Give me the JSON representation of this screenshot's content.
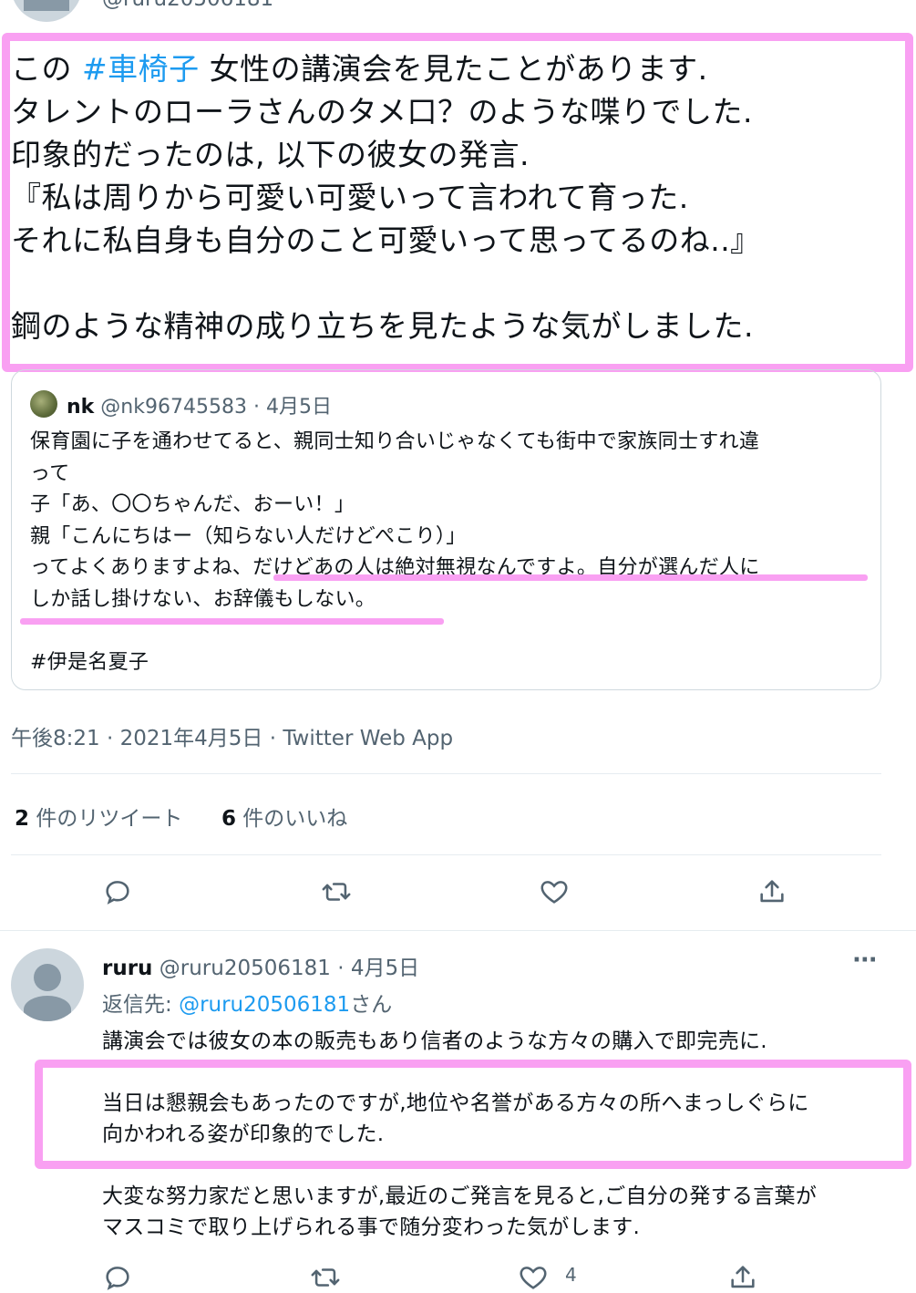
{
  "top_tweet": {
    "handle_partial": "@ruru20506181",
    "text_lines": [
      [
        "この ",
        "#車椅子",
        " 女性の講演会を見たことがあります."
      ],
      [
        "タレントのローラさんのタメ口？のような喋りでした."
      ],
      [
        "印象的だったのは, 以下の彼女の発言."
      ],
      [
        "『私は周りから可愛い可愛いって言われて育った."
      ],
      [
        "それに私自身も自分のこと可愛いって思ってるのね..』"
      ],
      [
        ""
      ],
      [
        "鋼のような精神の成り立ちを見たような気がしました."
      ]
    ],
    "hashtag": "#車椅子"
  },
  "quoted_tweet": {
    "name": "nk",
    "handle": "@nk96745583",
    "date": "· 4月5日",
    "lines": [
      "保育園に子を通わせてると、親同士知り合いじゃなくても街中で家族同士すれ違",
      "って",
      "子「あ、〇〇ちゃんだ、おーい！」",
      "親「こんにちはー（知らない人だけどぺこり）」",
      "ってよくありますよね、だけどあの人は絶対無視なんですよ。自分が選んだ人に",
      "しか話し掛けない、お辞儀もしない。",
      "",
      "#伊是名夏子"
    ]
  },
  "timestamp": "午後8:21 · 2021年4月5日 · Twitter Web App",
  "stats": {
    "retweet_count": "2",
    "retweet_label": " 件のリツイート",
    "like_count": "6",
    "like_label": " 件のいいね"
  },
  "actions": {
    "reply": "reply-icon",
    "retweet": "retweet-icon",
    "like": "heart-icon",
    "share": "share-icon"
  },
  "reply": {
    "name": "ruru",
    "handle": "@ruru20506181",
    "date": "· 4月5日",
    "more": "···",
    "reply_to_label": "返信先: ",
    "reply_to_handle": "@ruru20506181",
    "reply_to_suffix": "さん",
    "lines": [
      "講演会では彼女の本の販売もあり信者のような方々の購入で即完売に.",
      "",
      "当日は懇親会もあったのですが,地位や名誉がある方々の所へまっしぐらに",
      "向かわれる姿が印象的でした.",
      "",
      "大変な努力家だと思いますが,最近のご発言を見ると,ご自分の発する言葉が",
      "マスコミで取り上げられる事で随分変わった気がします."
    ],
    "like_count": "4"
  },
  "colors": {
    "highlight": "#f9a0f2",
    "link": "#1d9bf0",
    "secondary": "#536471"
  }
}
